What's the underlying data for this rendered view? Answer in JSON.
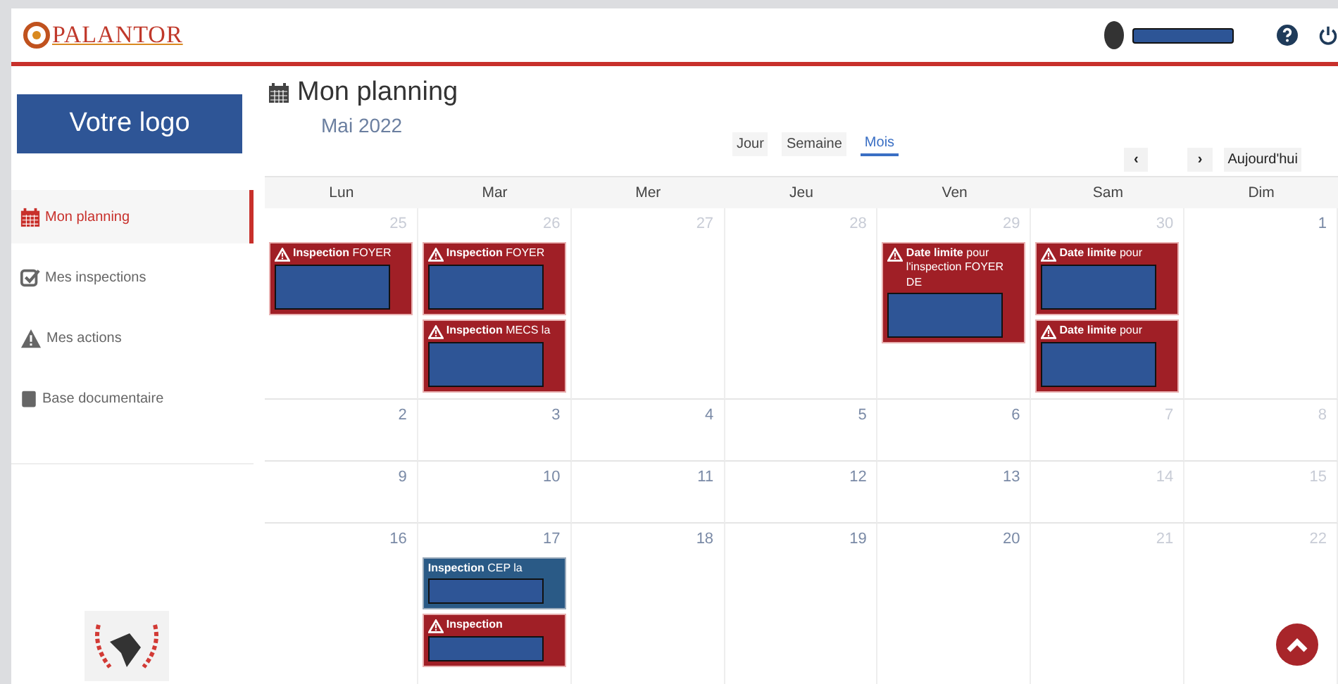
{
  "header": {
    "logo_text": "PALANTOR"
  },
  "sidebar": {
    "logo_placeholder": "Votre logo",
    "items": [
      {
        "label": "Mon planning",
        "selected": true
      },
      {
        "label": "Mes inspections",
        "selected": false
      },
      {
        "label": "Mes actions",
        "selected": false
      },
      {
        "label": "Base documentaire",
        "selected": false
      }
    ]
  },
  "page": {
    "title": "Mon planning",
    "month": "Mai 2022"
  },
  "views": [
    {
      "label": "Jour",
      "selected": false
    },
    {
      "label": "Semaine",
      "selected": false
    },
    {
      "label": "Mois",
      "selected": true
    }
  ],
  "nav": {
    "prev": "‹",
    "next": "›",
    "today": "Aujourd'hui"
  },
  "weekdays": [
    "Lun",
    "Mar",
    "Mer",
    "Jeu",
    "Ven",
    "Sam",
    "Dim"
  ],
  "weeks": [
    {
      "days": [
        {
          "number": "25",
          "muted": true,
          "events": [
            {
              "text": "**Inspection** FOYER",
              "kind": "alert"
            }
          ]
        },
        {
          "number": "26",
          "muted": true,
          "events": [
            {
              "text": "**Inspection** FOYER",
              "kind": "alert"
            },
            {
              "text": "**Inspection** MECS la",
              "kind": "alert"
            }
          ]
        },
        {
          "number": "27",
          "muted": true
        },
        {
          "number": "28",
          "muted": true
        },
        {
          "number": "29",
          "muted": true,
          "events": [
            {
              "text": "**Date limite** pour l'inspection FOYER DE",
              "kind": "alert"
            }
          ]
        },
        {
          "number": "30",
          "muted": true,
          "events": [
            {
              "text": "**Date limite** pour",
              "kind": "alert"
            },
            {
              "text": "**Date limite** pour",
              "kind": "alert"
            }
          ]
        },
        {
          "number": "1",
          "muted": false
        }
      ]
    },
    {
      "days": [
        {
          "number": "2",
          "muted": false
        },
        {
          "number": "3",
          "muted": false
        },
        {
          "number": "4",
          "muted": false
        },
        {
          "number": "5",
          "muted": false
        },
        {
          "number": "6",
          "muted": false
        },
        {
          "number": "7",
          "muted": true
        },
        {
          "number": "8",
          "muted": true
        }
      ]
    },
    {
      "days": [
        {
          "number": "9",
          "muted": false
        },
        {
          "number": "10",
          "muted": false
        },
        {
          "number": "11",
          "muted": false
        },
        {
          "number": "12",
          "muted": false
        },
        {
          "number": "13",
          "muted": false
        },
        {
          "number": "14",
          "muted": true
        },
        {
          "number": "15",
          "muted": true
        }
      ]
    },
    {
      "days": [
        {
          "number": "16",
          "muted": false
        },
        {
          "number": "17",
          "muted": false,
          "events": [
            {
              "text": "**Inspection** CEP la",
              "kind": "planned"
            },
            {
              "text": "**Inspection**",
              "kind": "alert"
            }
          ]
        },
        {
          "number": "18",
          "muted": false
        },
        {
          "number": "19",
          "muted": false
        },
        {
          "number": "20",
          "muted": false
        },
        {
          "number": "21",
          "muted": true
        },
        {
          "number": "22",
          "muted": true
        }
      ]
    }
  ]
}
